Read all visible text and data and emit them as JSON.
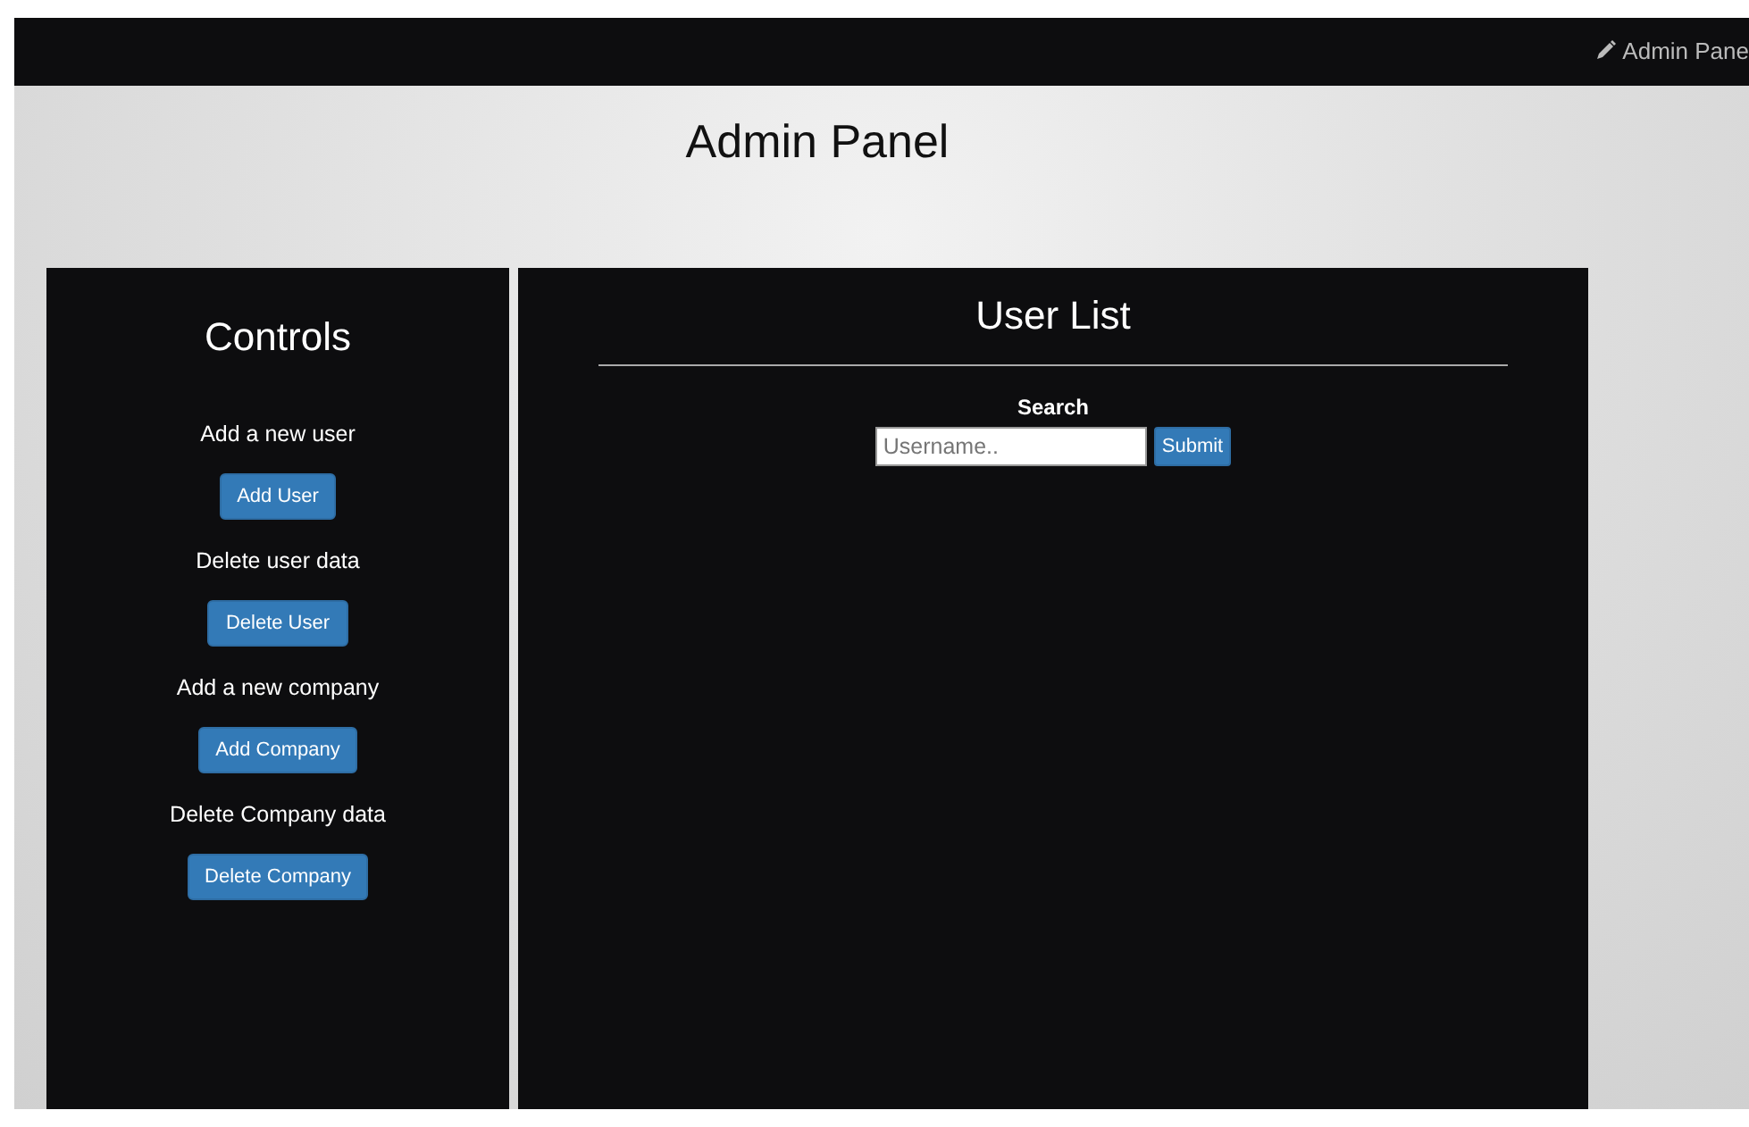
{
  "navbar": {
    "link": "Admin Pane"
  },
  "page_title": "Admin Panel",
  "controls": {
    "title": "Controls",
    "actions": [
      {
        "label": "Add a new user",
        "button": "Add User"
      },
      {
        "label": "Delete user data",
        "button": "Delete User"
      },
      {
        "label": "Add a new company",
        "button": "Add Company"
      },
      {
        "label": "Delete Company data",
        "button": "Delete Company"
      }
    ]
  },
  "user_list": {
    "title": "User List",
    "search_label": "Search",
    "search": {
      "placeholder": "Username.."
    },
    "submit": "Submit"
  }
}
